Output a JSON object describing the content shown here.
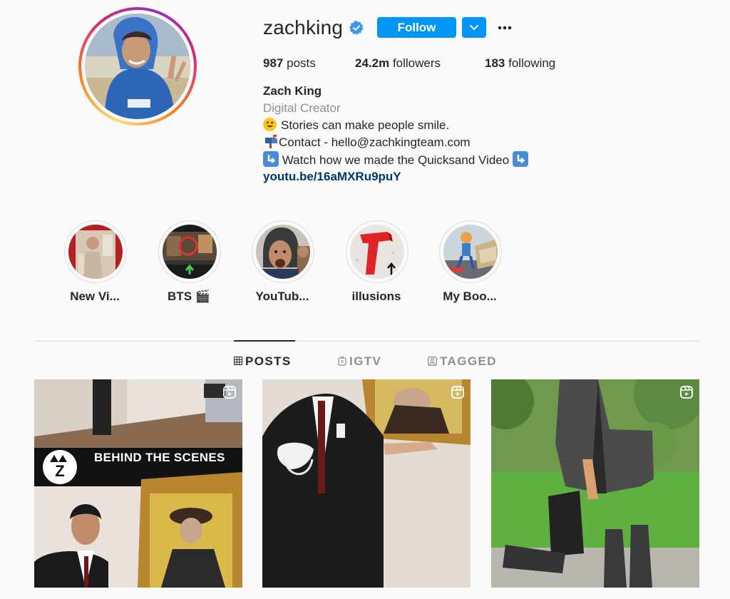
{
  "profile": {
    "username": "zachking",
    "follow_label": "Follow",
    "stats": {
      "posts_count": "987",
      "posts_label": "posts",
      "followers_count": "24.2m",
      "followers_label": "followers",
      "following_count": "183",
      "following_label": "following"
    },
    "full_name": "Zach King",
    "category": "Digital Creator",
    "bio": {
      "line1": "Stories can make people smile.",
      "line2": "Contact - hello@zachkingteam.com",
      "line3": "Watch how we made the Quicksand Video",
      "link": "youtu.be/16aMXRu9puY"
    }
  },
  "highlights": [
    {
      "label": "New Vi..."
    },
    {
      "label": "BTS 🎬"
    },
    {
      "label": "YouTub..."
    },
    {
      "label": "illusions"
    },
    {
      "label": "My Boo..."
    }
  ],
  "tabs": [
    {
      "label": "POSTS",
      "icon": "grid-icon",
      "active": true
    },
    {
      "label": "IGTV",
      "icon": "igtv-icon",
      "active": false
    },
    {
      "label": "TAGGED",
      "icon": "tagged-icon",
      "active": false
    }
  ],
  "posts": [
    {
      "overlay_text": "BEHIND THE SCENES",
      "icon": "reel-icon"
    },
    {
      "overlay_text": "",
      "icon": "reel-icon"
    },
    {
      "overlay_text": "",
      "icon": "reel-icon"
    }
  ],
  "colors": {
    "primary_button": "#0095f6",
    "link": "#00376b",
    "muted_text": "#8e8e8e",
    "background": "#fafafa"
  }
}
